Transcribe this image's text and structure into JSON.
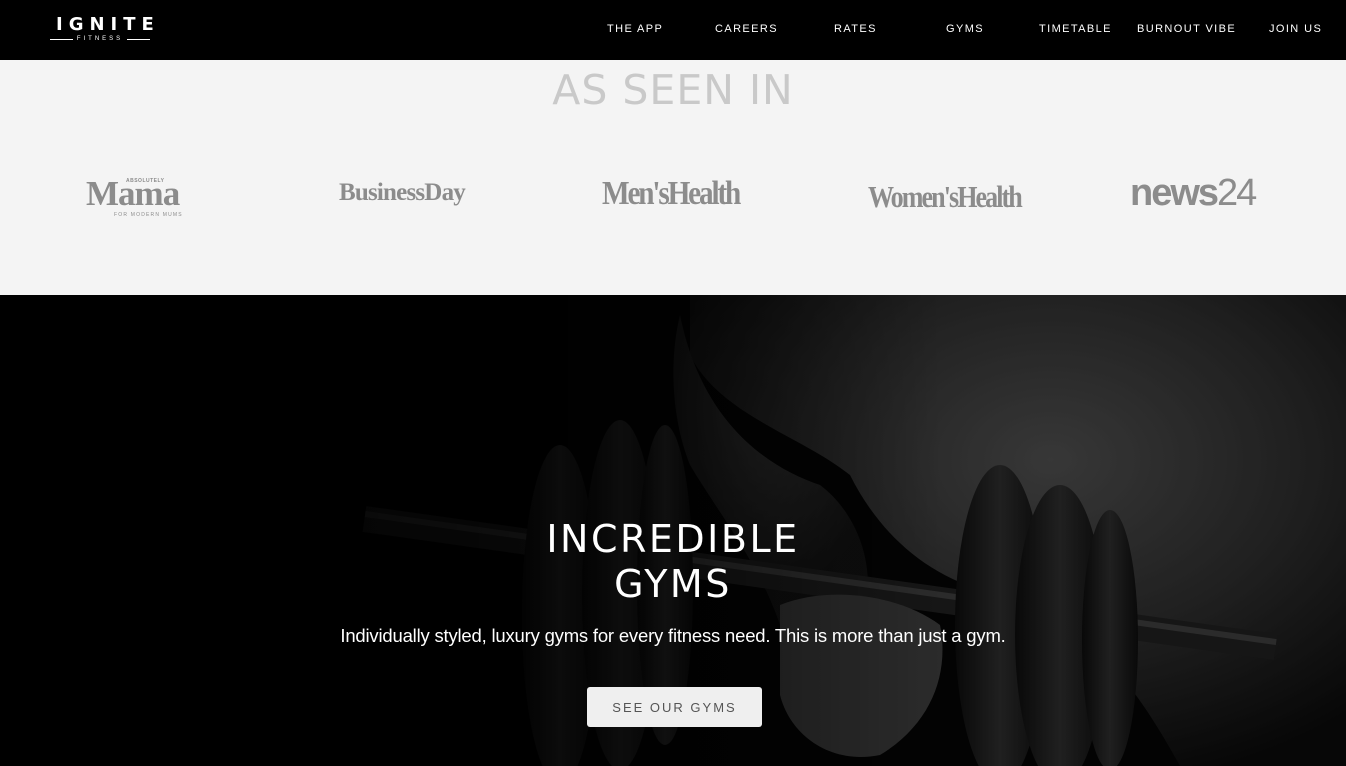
{
  "logo": {
    "main": "IGNITE",
    "sub": "FITNESS"
  },
  "nav": {
    "items": [
      {
        "label": "THE APP"
      },
      {
        "label": "CAREERS"
      },
      {
        "label": "RATES"
      },
      {
        "label": "GYMS"
      },
      {
        "label": "TIMETABLE"
      },
      {
        "label": "BURNOUT VIBE"
      },
      {
        "label": "JOIN US"
      }
    ]
  },
  "press": {
    "title": "AS SEEN IN",
    "logos": {
      "mama": {
        "small": "ABSOLUTELY",
        "main": "Mama",
        "tag": "FOR MODERN MUMS"
      },
      "businessday": "BusinessDay",
      "menshealth": "Men'sHealth",
      "womenshealth": "Women'sHealth",
      "news24": {
        "word": "news",
        "num": "24"
      }
    }
  },
  "hero": {
    "title_line1": "INCREDIBLE",
    "title_line2": "GYMS",
    "text": "Individually styled, luxury gyms for every fitness need. This is more than just a gym.",
    "button": "SEE OUR GYMS"
  },
  "colors": {
    "nav_bg": "#000000",
    "press_bg": "#f4f4f4",
    "press_title": "#c9c9c9",
    "press_logo": "#8c8c8c",
    "button_bg": "#efefef"
  }
}
